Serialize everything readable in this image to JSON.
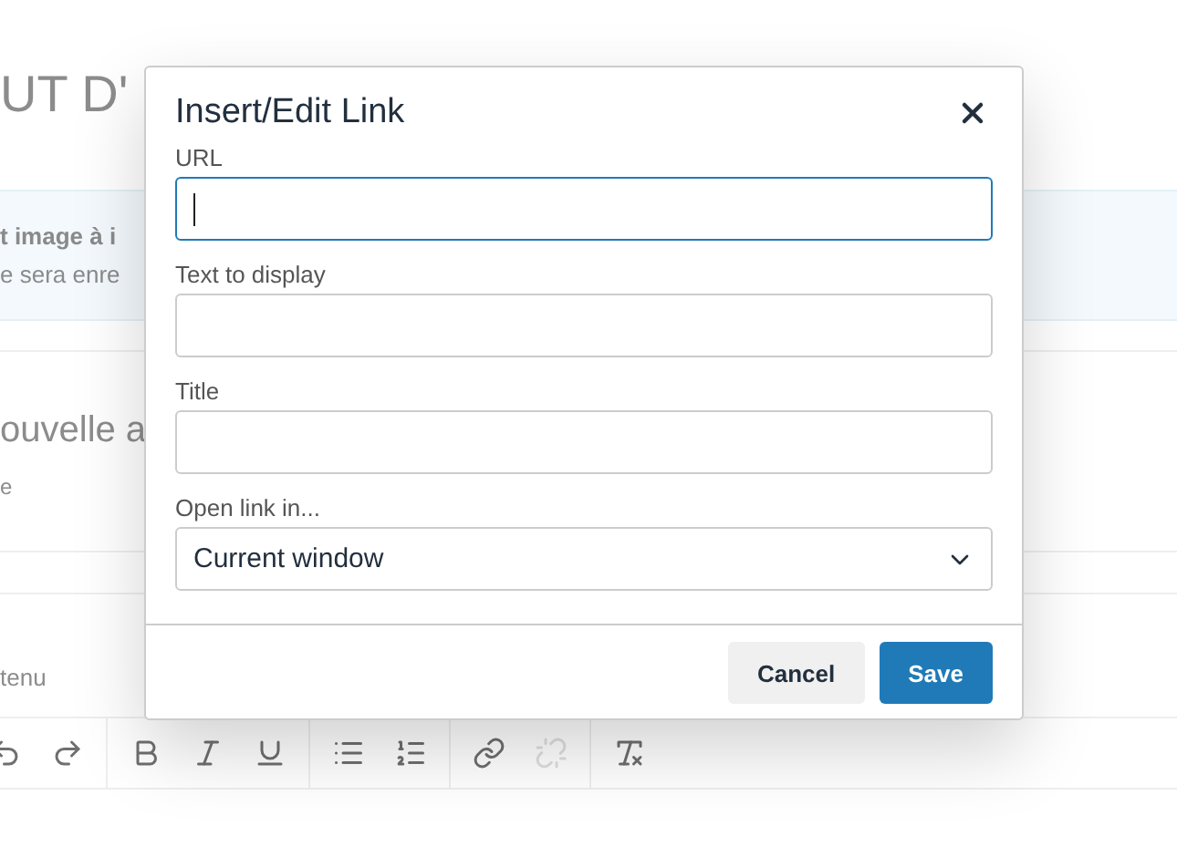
{
  "background_page": {
    "heading": "UT D'",
    "notice": {
      "line_1": "t image à i",
      "line_2": "e sera enre"
    },
    "section_heading": "ouvelle a",
    "section_hint": "e",
    "content_label": "tenu",
    "toolbar": [
      {
        "kind": "undo",
        "disabled": false
      },
      {
        "kind": "redo",
        "disabled": false
      },
      {
        "kind": "sep"
      },
      {
        "kind": "bold",
        "disabled": false
      },
      {
        "kind": "italic",
        "disabled": false
      },
      {
        "kind": "underline",
        "disabled": false
      },
      {
        "kind": "sep"
      },
      {
        "kind": "bullets",
        "disabled": false
      },
      {
        "kind": "numbers",
        "disabled": false
      },
      {
        "kind": "sep"
      },
      {
        "kind": "link",
        "disabled": false
      },
      {
        "kind": "unlink",
        "disabled": true
      },
      {
        "kind": "sep"
      },
      {
        "kind": "clear",
        "disabled": false
      }
    ]
  },
  "dialog": {
    "title": "Insert/Edit Link",
    "fields": [
      {
        "kind": "text",
        "label": "URL",
        "focused": true
      },
      {
        "kind": "text",
        "label": "Text to display",
        "focused": false
      },
      {
        "kind": "text",
        "label": "Title",
        "focused": false
      },
      {
        "kind": "select",
        "label": "Open link in...",
        "value": "Current window",
        "focused": false
      }
    ],
    "buttons": [
      {
        "label": "Cancel",
        "primary": false
      },
      {
        "label": "Save",
        "primary": true
      }
    ]
  }
}
